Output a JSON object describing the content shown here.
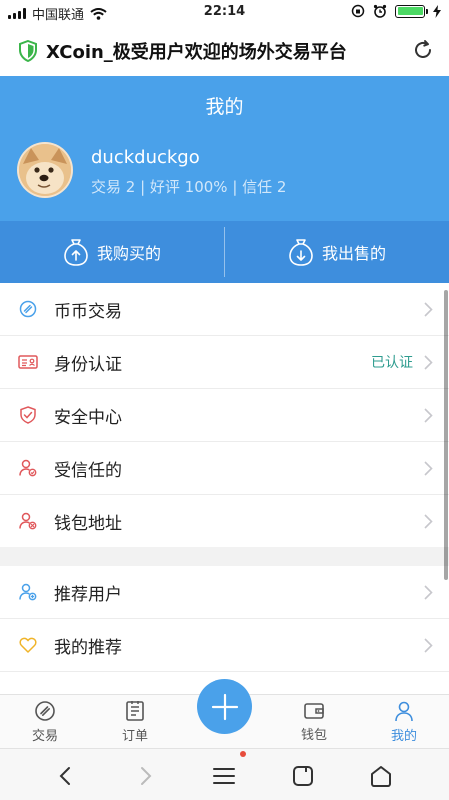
{
  "status_bar": {
    "carrier": "中国联通",
    "time": "22:14",
    "battery_color": "#4cd964"
  },
  "url_bar": {
    "title": "XCoin_极受用户欢迎的场外交易平台",
    "shield_color": "#3bb54a"
  },
  "profile": {
    "page_title": "我的",
    "username": "duckduckgo",
    "stats": "交易 2 | 好评 100% | 信任 2",
    "header_color": "#4aa1ea"
  },
  "actions": {
    "buy": "我购买的",
    "sell": "我出售的"
  },
  "menu_group_1": [
    {
      "label": "币币交易",
      "icon": "coin-exchange-icon",
      "icon_color": "#4aa1ea"
    },
    {
      "label": "身份认证",
      "icon": "id-card-icon",
      "icon_color": "#e0585b",
      "badge": "已认证"
    },
    {
      "label": "安全中心",
      "icon": "shield-check-icon",
      "icon_color": "#e0585b"
    },
    {
      "label": "受信任的",
      "icon": "trusted-user-icon",
      "icon_color": "#e0585b"
    },
    {
      "label": "钱包地址",
      "icon": "wallet-user-icon",
      "icon_color": "#e0585b"
    }
  ],
  "menu_group_2": [
    {
      "label": "推荐用户",
      "icon": "recommend-user-icon",
      "icon_color": "#4aa1ea"
    },
    {
      "label": "我的推荐",
      "icon": "heart-icon",
      "icon_color": "#f0b429"
    }
  ],
  "tabs": [
    {
      "label": "交易",
      "icon": "trade-icon"
    },
    {
      "label": "订单",
      "icon": "order-icon"
    },
    {
      "label": "钱包",
      "icon": "wallet-icon"
    },
    {
      "label": "我的",
      "icon": "profile-icon",
      "active": true
    }
  ],
  "accent_color": "#3e8edd"
}
